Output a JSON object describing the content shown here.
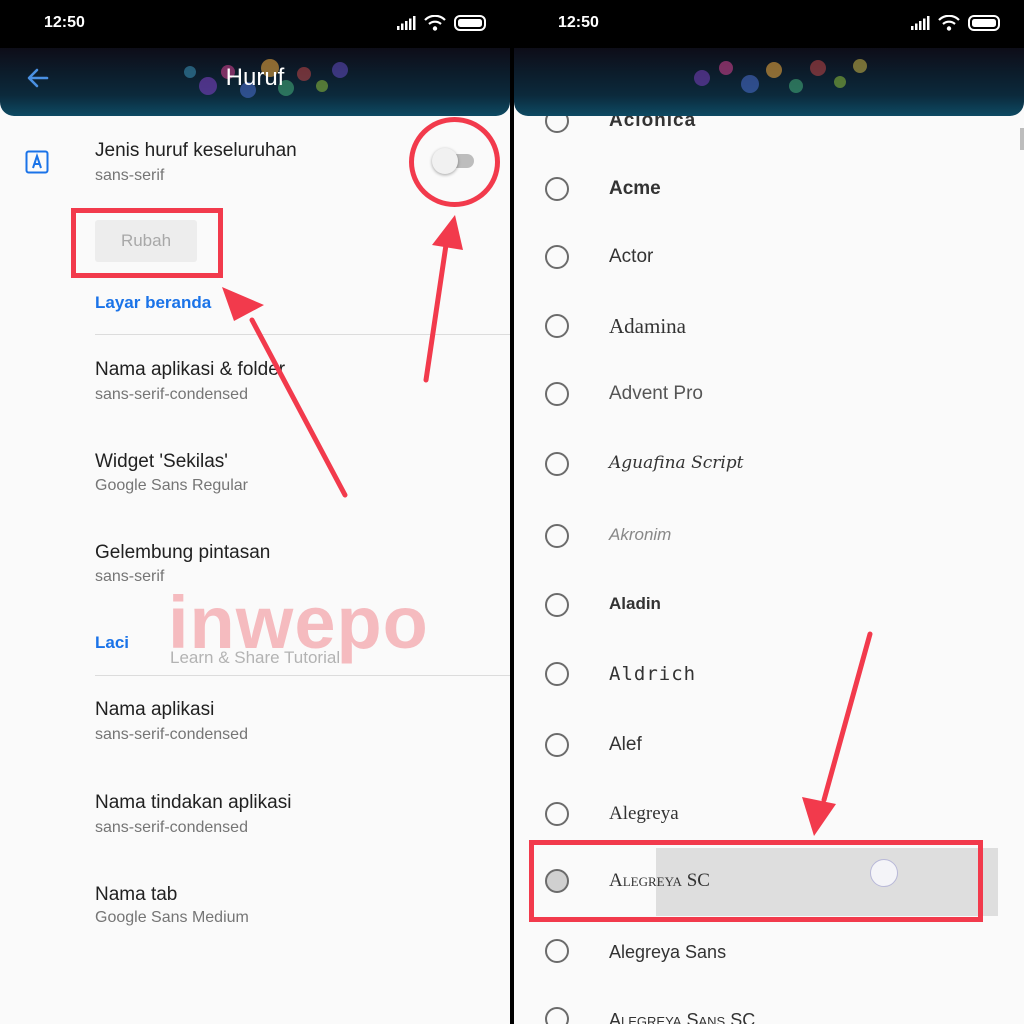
{
  "left": {
    "status_time": "12:50",
    "title": "Huruf",
    "overall": {
      "title": "Jenis huruf keseluruhan",
      "subtitle": "sans-serif",
      "toggle_on": false
    },
    "change_button": "Rubah",
    "section_home": "Layar beranda",
    "home_items": [
      {
        "title": "Nama aplikasi & folder",
        "subtitle": "sans-serif-condensed"
      },
      {
        "title": "Widget 'Sekilas'",
        "subtitle": "Google Sans Regular"
      },
      {
        "title": "Gelembung pintasan",
        "subtitle": "sans-serif"
      }
    ],
    "section_drawer": "Laci",
    "drawer_items": [
      {
        "title": "Nama aplikasi",
        "subtitle": "sans-serif-condensed"
      },
      {
        "title": "Nama tindakan aplikasi",
        "subtitle": "sans-serif-condensed"
      },
      {
        "title": "Nama tab",
        "subtitle": "Google Sans Medium"
      }
    ],
    "watermark": {
      "brand": "inwepo",
      "tagline": "Learn & Share Tutorial"
    }
  },
  "right": {
    "status_time": "12:50",
    "fonts": [
      "Aclonica",
      "Acme",
      "Actor",
      "Adamina",
      "Advent Pro",
      "Aguafina Script",
      "Akronim",
      "Aladin",
      "Aldrich",
      "Alef",
      "Alegreya",
      "Alegreya SC",
      "Alegreya Sans",
      "Alegreya Sans SC"
    ],
    "highlighted_font": "Alegreya SC"
  },
  "colors": {
    "accent": "#1a73e8",
    "annotation": "#f23a4c",
    "header_dark": "#0c2a3c",
    "text_primary": "#212121",
    "text_secondary": "#757575"
  }
}
